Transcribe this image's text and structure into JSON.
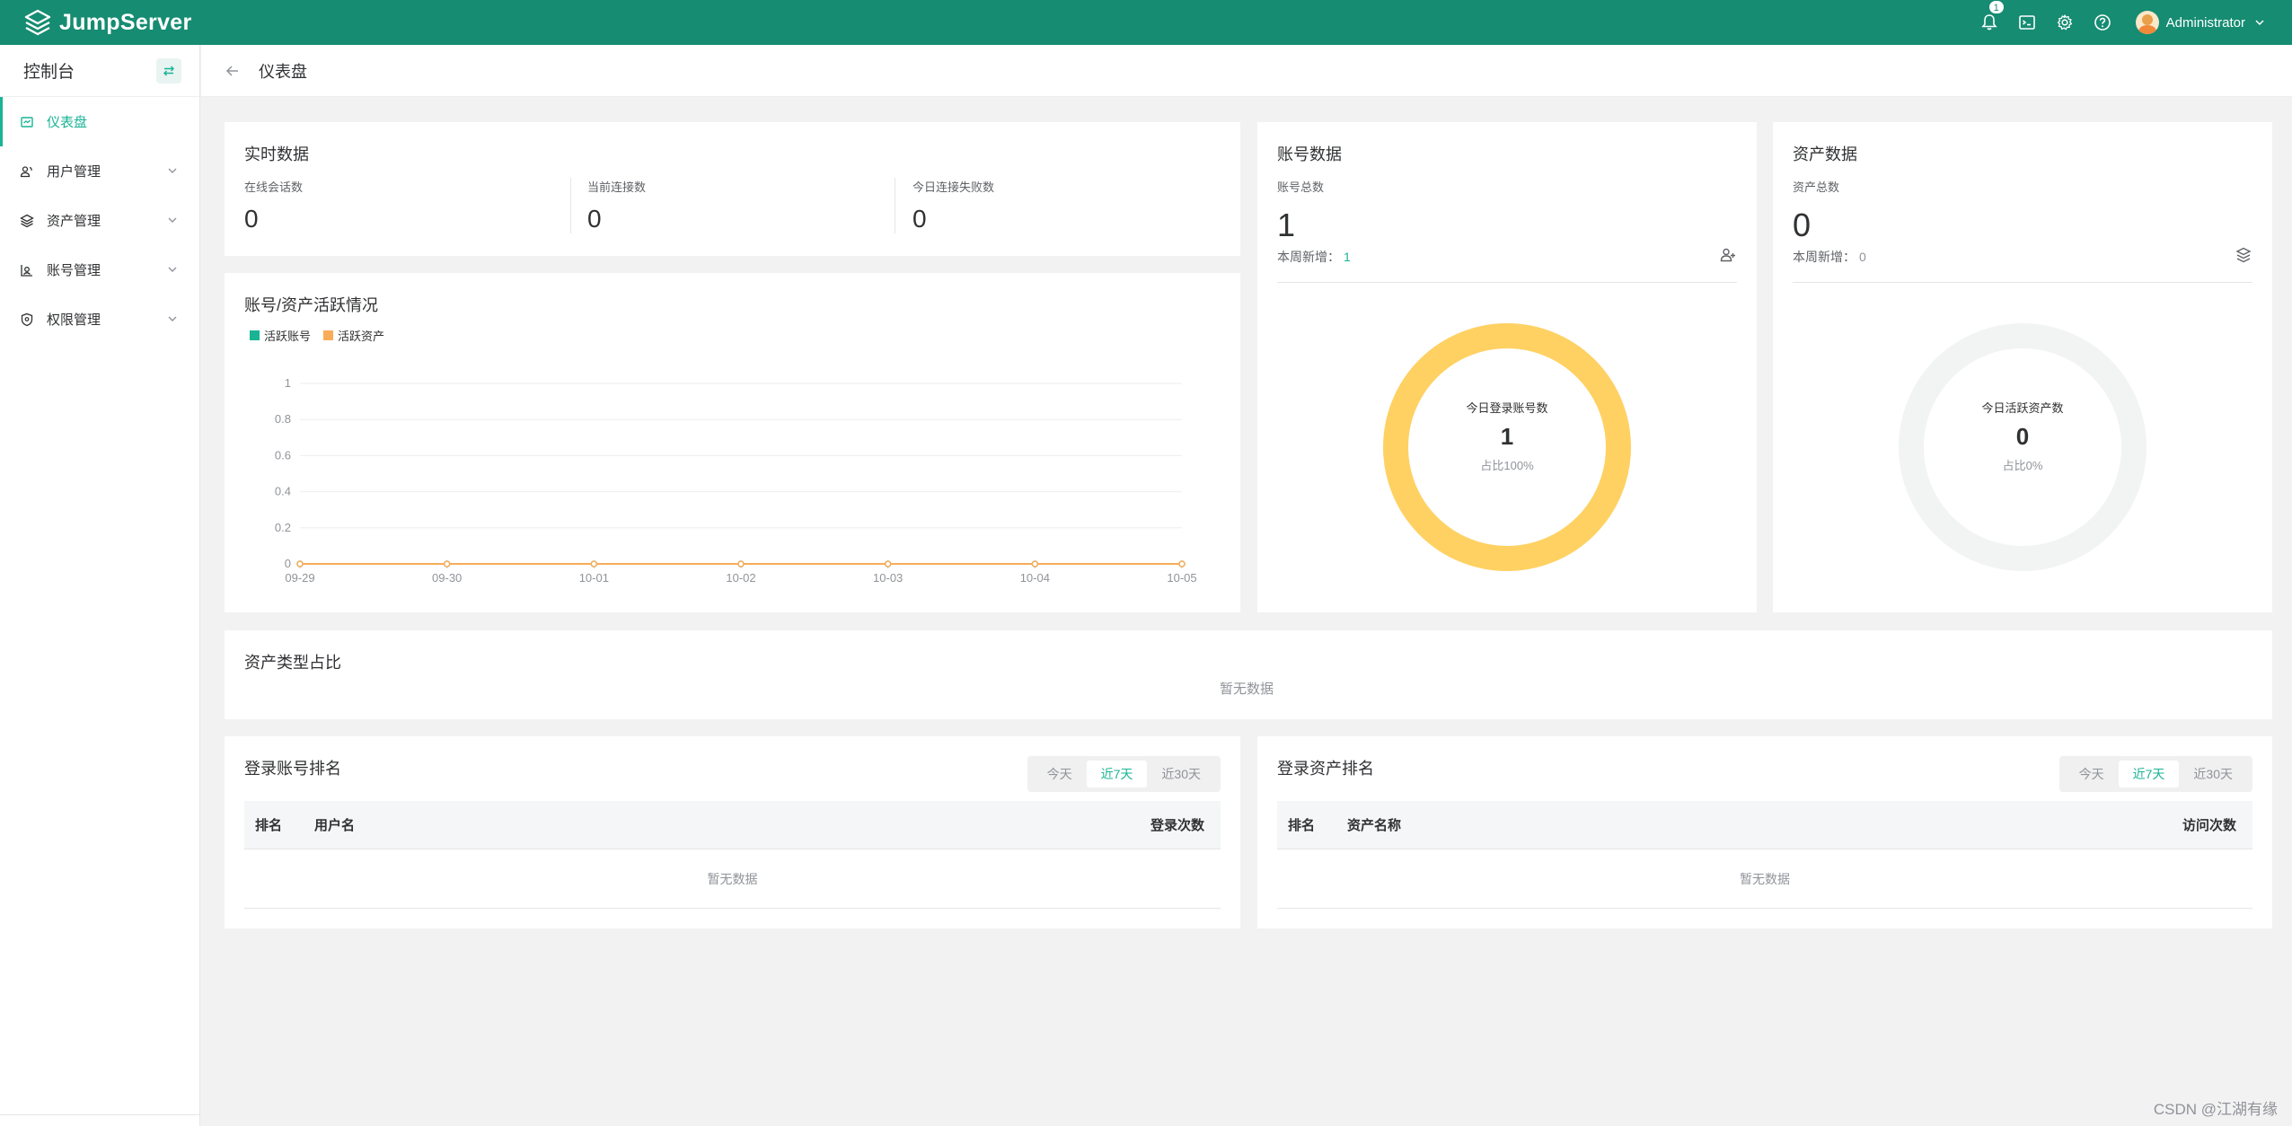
{
  "app": {
    "logo_text": "JumpServer"
  },
  "topbar": {
    "notification_count": "1",
    "user_name": "Administrator"
  },
  "sidebar": {
    "title": "控制台",
    "items": [
      {
        "label": "仪表盘",
        "icon": "dashboard-icon",
        "active": true
      },
      {
        "label": "用户管理",
        "icon": "users-icon",
        "active": false
      },
      {
        "label": "资产管理",
        "icon": "assets-icon",
        "active": false
      },
      {
        "label": "账号管理",
        "icon": "accounts-icon",
        "active": false
      },
      {
        "label": "权限管理",
        "icon": "permissions-icon",
        "active": false
      }
    ]
  },
  "breadcrumb": {
    "title": "仪表盘"
  },
  "realtime": {
    "title": "实时数据",
    "stats": [
      {
        "label": "在线会话数",
        "value": "0"
      },
      {
        "label": "当前连接数",
        "value": "0"
      },
      {
        "label": "今日连接失败数",
        "value": "0"
      }
    ]
  },
  "account_card": {
    "title": "账号数据",
    "total_label": "账号总数",
    "total_value": "1",
    "week_label": "本周新增：",
    "week_value": "1",
    "donut_label": "今日登录账号数",
    "donut_value": "1",
    "donut_pct": "占比100%",
    "donut_fraction": 1.0,
    "donut_color": "#ffd162"
  },
  "asset_card": {
    "title": "资产数据",
    "total_label": "资产总数",
    "total_value": "0",
    "week_label": "本周新增：",
    "week_value": "0",
    "donut_label": "今日活跃资产数",
    "donut_value": "0",
    "donut_pct": "占比0%",
    "donut_fraction": 0.0,
    "donut_color": "#f2f4f3"
  },
  "activity": {
    "title": "账号/资产活跃情况",
    "legend": [
      {
        "name": "活跃账号",
        "color": "#1ab394"
      },
      {
        "name": "活跃资产",
        "color": "#f8ac59"
      }
    ]
  },
  "chart_data": {
    "type": "line",
    "title": "账号/资产活跃情况",
    "categories": [
      "09-29",
      "09-30",
      "10-01",
      "10-02",
      "10-03",
      "10-04",
      "10-05"
    ],
    "series": [
      {
        "name": "活跃账号",
        "color": "#1ab394",
        "values": [
          0,
          0,
          0,
          0,
          0,
          0,
          0
        ]
      },
      {
        "name": "活跃资产",
        "color": "#f8ac59",
        "values": [
          0,
          0,
          0,
          0,
          0,
          0,
          0
        ]
      }
    ],
    "ylim": [
      0,
      1
    ],
    "yticks": [
      "0",
      "0.2",
      "0.4",
      "0.6",
      "0.8",
      "1"
    ],
    "grid": true,
    "legend_position": "top-left"
  },
  "asset_type": {
    "title": "资产类型占比",
    "empty": "暂无数据"
  },
  "login_account_rank": {
    "title": "登录账号排名",
    "tabs": [
      "今天",
      "近7天",
      "近30天"
    ],
    "active_tab": 1,
    "columns": [
      "排名",
      "用户名",
      "登录次数"
    ],
    "empty": "暂无数据"
  },
  "login_asset_rank": {
    "title": "登录资产排名",
    "tabs": [
      "今天",
      "近7天",
      "近30天"
    ],
    "active_tab": 1,
    "columns": [
      "排名",
      "资产名称",
      "访问次数"
    ],
    "empty": "暂无数据"
  },
  "watermark": "CSDN @江湖有缘"
}
